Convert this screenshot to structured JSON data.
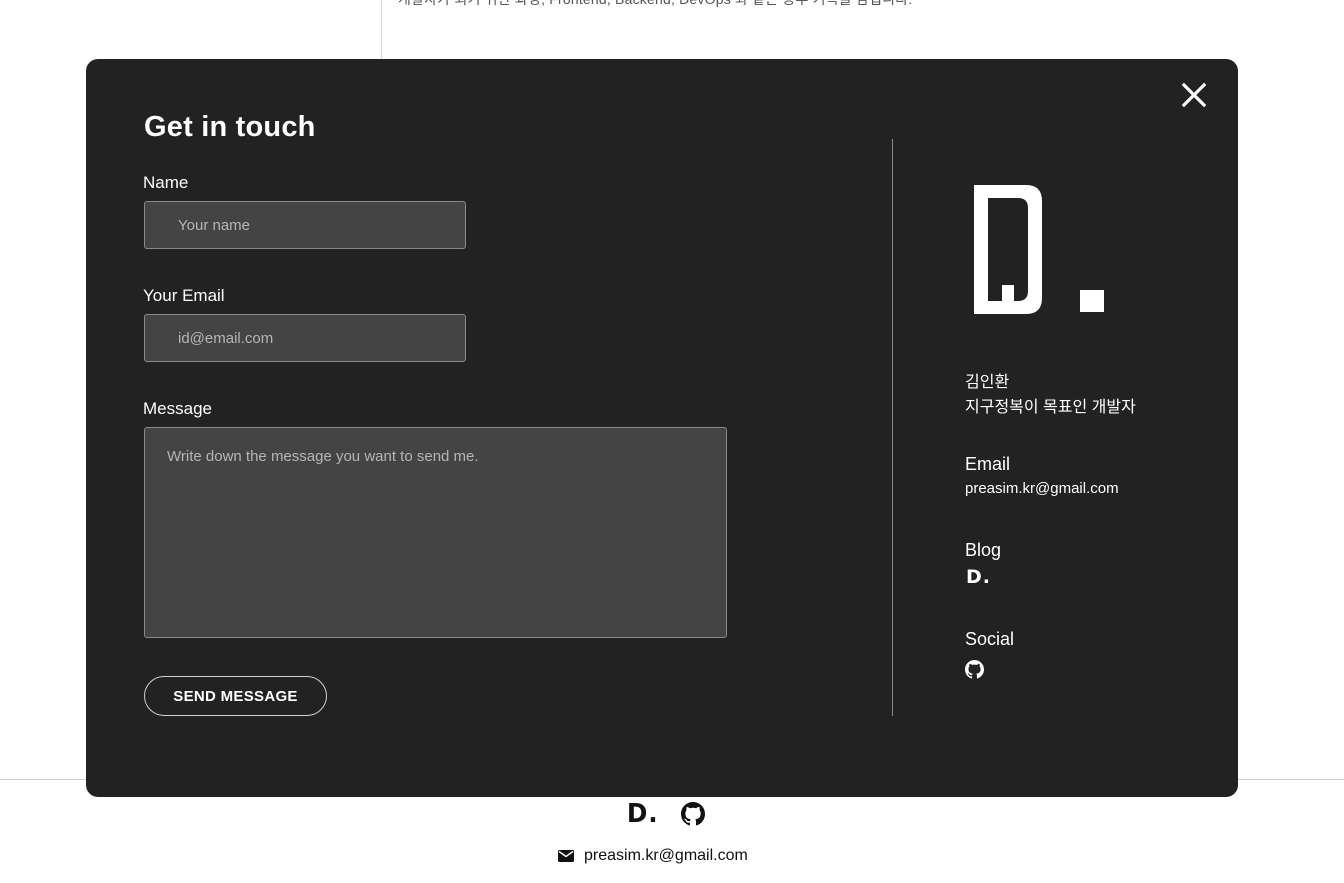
{
  "background": {
    "top_text": "개발자가 되기 위한 과정, Frontend, Backend, DevOps 와 같은 공부 기록을 남깁니다.",
    "footer": {
      "logo_text": "D.",
      "email": "preasim.kr@gmail.com"
    }
  },
  "modal": {
    "title": "Get in touch",
    "form": {
      "name_label": "Name",
      "name_placeholder": "Your name",
      "email_label": "Your Email",
      "email_placeholder": "id@email.com",
      "message_label": "Message",
      "message_placeholder": "Write down the message you want to send me.",
      "submit_label": "SEND MESSAGE"
    },
    "profile": {
      "logo_text": "D.",
      "name": "김인환",
      "tagline": "지구정복이 목표인 개발자",
      "email_label": "Email",
      "email_value": "preasim.kr@gmail.com",
      "blog_label": "Blog",
      "blog_mark": "D.",
      "social_label": "Social"
    }
  },
  "icons": {
    "close": "close-icon",
    "github": "github-icon",
    "mail": "mail-icon"
  },
  "colors": {
    "modal_bg": "#222222",
    "input_bg": "#444444",
    "text": "#ffffff"
  }
}
